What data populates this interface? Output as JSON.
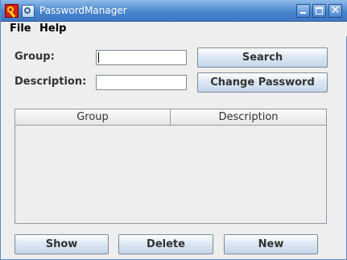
{
  "window": {
    "title": "PasswordManager",
    "controls": {
      "minimize": "minimize",
      "maximize": "maximize",
      "close": "✕"
    }
  },
  "menubar": {
    "items": [
      {
        "label": "File"
      },
      {
        "label": "Help"
      }
    ]
  },
  "form": {
    "group_label": "Group:",
    "group_value": "",
    "description_label": "Description:",
    "description_value": "",
    "search_button": "Search",
    "change_password_button": "Change Password"
  },
  "table": {
    "columns": [
      "Group",
      "Description"
    ],
    "rows": []
  },
  "actions": {
    "show_button": "Show",
    "delete_button": "Delete",
    "new_button": "New"
  },
  "colors": {
    "titlebar": "#4a86cd",
    "app_icon": "#d42020",
    "window_bg": "#eeeeee"
  },
  "icons": {
    "app": "key-icon",
    "window_menu": "window-menu-icon"
  }
}
